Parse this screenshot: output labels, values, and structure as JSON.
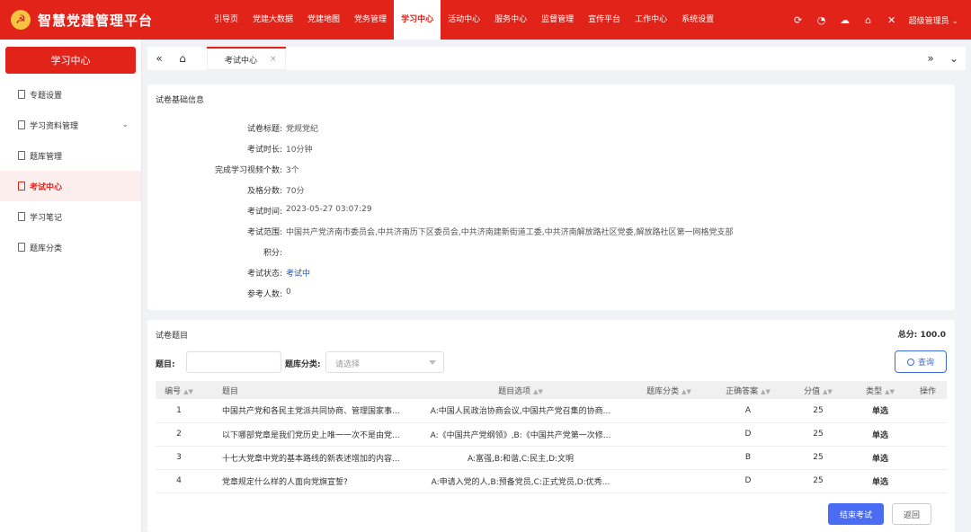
{
  "header": {
    "title": "智慧党建管理平台",
    "emblem": "☭",
    "nav": [
      "引导页",
      "党建大数据",
      "党建地图",
      "党务管理",
      "学习中心",
      "活动中心",
      "服务中心",
      "监督管理",
      "宣传平台",
      "工作中心",
      "系统设置"
    ],
    "active_nav": "学习中心",
    "user": "超级管理员 ⌄",
    "accent": "#e2231a"
  },
  "sidebar": {
    "heading": "学习中心",
    "items": [
      "专题设置",
      "学习资料管理",
      "题库管理",
      "考试中心",
      "学习笔记",
      "题库分类"
    ],
    "active": "考试中心"
  },
  "tabs": {
    "items": [
      "考试中心"
    ]
  },
  "exam_info": {
    "section_title": "试卷基础信息",
    "fields": [
      {
        "label": "试卷标题:",
        "value": "党规党纪"
      },
      {
        "label": "考试时长:",
        "value": "10分钟"
      },
      {
        "label": "完成学习视频个数:",
        "value": "3个"
      },
      {
        "label": "及格分数:",
        "value": "70分"
      },
      {
        "label": "考试时间:",
        "value": "2023-05-27 03:07:29"
      },
      {
        "label": "考试范围:",
        "value": "中国共产党济南市委员会,中共济南历下区委员会,中共济南建新街道工委,中共济南解放路社区党委,解放路社区第一网格党支部"
      },
      {
        "label": "积分:",
        "value": ""
      },
      {
        "label": "考试状态:",
        "value": "考试中"
      },
      {
        "label": "参考人数:",
        "value": "0"
      }
    ]
  },
  "questions": {
    "section_title": "试卷题目",
    "total": "总分:  100.0",
    "filter": {
      "title_label": "题目:",
      "title_value": "",
      "category_label": "题库分类:",
      "category_placeholder": "请选择",
      "query_label": "查询"
    },
    "columns": [
      "编号",
      "题目",
      "题目选项",
      "题库分类",
      "正确答案",
      "分值",
      "类型",
      "操作"
    ],
    "rows": [
      {
        "no": "1",
        "title": "中国共产党和各民主党派共同协商、管理国家事...",
        "options": "A:中国人民政治协商会议,中国共产党召集的协商...",
        "category": "",
        "answer": "A",
        "score": "25",
        "type": "单选"
      },
      {
        "no": "2",
        "title": "以下哪部党章是我们党历史上唯一一次不是由党...",
        "options": "A:《中国共产党纲领》,B:《中国共产党第一次修...",
        "category": "",
        "answer": "D",
        "score": "25",
        "type": "单选"
      },
      {
        "no": "3",
        "title": "十七大党章中党的基本路线的新表述增加的内容...",
        "options": "A:富强,B:和谐,C:民主,D:文明",
        "category": "",
        "answer": "B",
        "score": "25",
        "type": "单选"
      },
      {
        "no": "4",
        "title": "党章规定什么样的人面向党旗宣誓?",
        "options": "A:申请入党的人,B:预备党员,C:正式党员,D:优秀...",
        "category": "",
        "answer": "D",
        "score": "25",
        "type": "单选"
      }
    ],
    "end_label": "结束考试",
    "back_label": "返回"
  }
}
